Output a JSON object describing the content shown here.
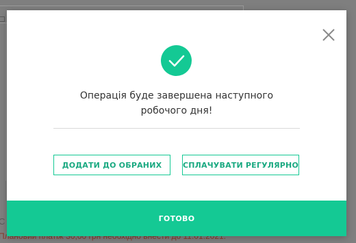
{
  "background": {
    "partial_letter": "С",
    "partial_note": "Плановий платіж 30,00 грн необхідно внести до 11.01.2021."
  },
  "modal": {
    "close_icon": "close-icon",
    "success_icon": "check-circle-icon",
    "message_line1": "Операція буде завершена наступного",
    "message_line2": "робочого дня!",
    "add_favorites_label": "ДОДАТИ ДО ОБРАНИХ",
    "pay_regularly_label": "СПЛАЧУВАТИ РЕГУЛЯРНО",
    "done_label": "ГОТОВО"
  },
  "colors": {
    "accent": "#14c994",
    "accent_text": "#1aa981",
    "backdrop": "#7f7f7f",
    "text": "#333333"
  }
}
